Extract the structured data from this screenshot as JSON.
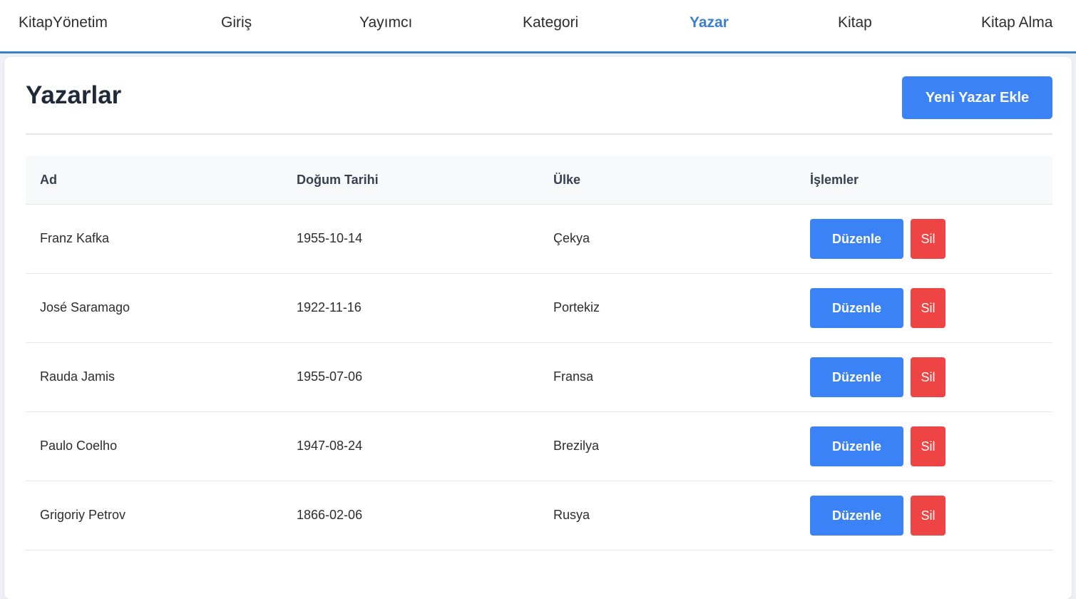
{
  "nav": {
    "brand": "KitapYönetim",
    "items": [
      {
        "label": "Giriş",
        "active": false
      },
      {
        "label": "Yayımcı",
        "active": false
      },
      {
        "label": "Kategori",
        "active": false
      },
      {
        "label": "Yazar",
        "active": true
      },
      {
        "label": "Kitap",
        "active": false
      },
      {
        "label": "Kitap Alma",
        "active": false
      }
    ]
  },
  "page": {
    "title": "Yazarlar",
    "add_button": "Yeni Yazar Ekle"
  },
  "table": {
    "headers": [
      "Ad",
      "Doğum Tarihi",
      "Ülke",
      "İşlemler"
    ],
    "rows": [
      {
        "name": "Franz Kafka",
        "birth_date": "1955-10-14",
        "country": "Çekya",
        "edit": "Düzenle",
        "delete": "Sil"
      },
      {
        "name": "José Saramago",
        "birth_date": "1922-11-16",
        "country": "Portekiz",
        "edit": "Düzenle",
        "delete": "Sil"
      },
      {
        "name": "Rauda Jamis",
        "birth_date": "1955-07-06",
        "country": "Fransa",
        "edit": "Düzenle",
        "delete": "Sil"
      },
      {
        "name": "Paulo Coelho",
        "birth_date": "1947-08-24",
        "country": "Brezilya",
        "edit": "Düzenle",
        "delete": "Sil"
      },
      {
        "name": "Grigoriy Petrov",
        "birth_date": "1866-02-06",
        "country": "Rusya",
        "edit": "Düzenle",
        "delete": "Sil"
      }
    ]
  },
  "colors": {
    "accent": "#3b7fd0",
    "primary_button": "#3b82f6",
    "danger_button": "#ef4444",
    "page_background": "#eef0f5"
  }
}
